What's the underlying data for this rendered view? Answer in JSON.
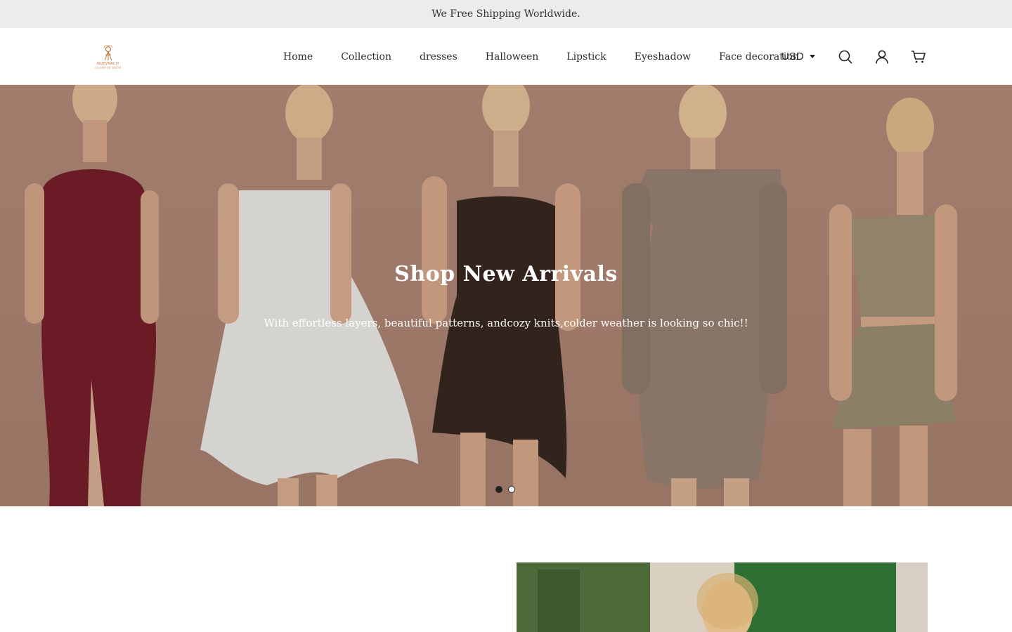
{
  "announcement": "We Free Shipping Worldwide.",
  "logo": {
    "text": "NUEVNACIY",
    "subtext": "GLAMOUR WEAR"
  },
  "nav": {
    "items": [
      {
        "label": "Home"
      },
      {
        "label": "Collection"
      },
      {
        "label": "dresses"
      },
      {
        "label": "Halloween"
      },
      {
        "label": "Lipstick"
      },
      {
        "label": "Eyeshadow"
      },
      {
        "label": "Face decoration"
      }
    ]
  },
  "tools": {
    "currency": "USD",
    "icons": [
      "search-icon",
      "account-icon",
      "cart-icon"
    ]
  },
  "hero": {
    "title": "Shop New Arrivals",
    "subtitle": "With effortless layers, beautiful patterns, andcozy knits,colder weather is looking so chic!!",
    "slides_total": 2,
    "active_slide": 1
  },
  "colors": {
    "announce_bg": "#ececec",
    "hero_bg": "#b48a78",
    "accent": "#222222"
  }
}
